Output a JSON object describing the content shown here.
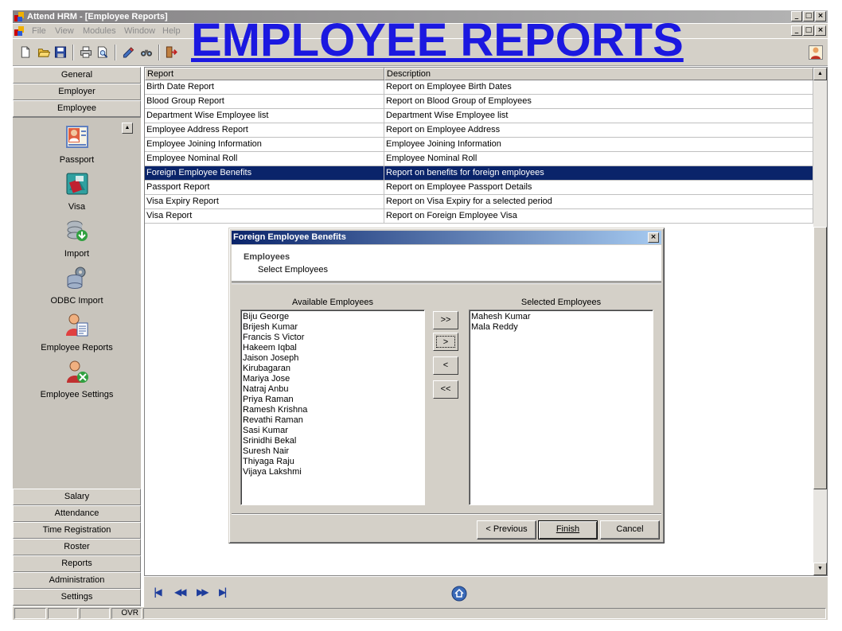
{
  "window": {
    "title": "Attend HRM - [Employee Reports]",
    "controls": {
      "minimize": "_",
      "maximize": "□",
      "close": "×"
    }
  },
  "menu": [
    "File",
    "View",
    "Modules",
    "Window",
    "Help"
  ],
  "overlay_title": "EMPLOYEE REPORTS",
  "categories_top": [
    "General",
    "Employer",
    "Employee"
  ],
  "nav_items": [
    {
      "label": "Passport",
      "icon": "passport-icon"
    },
    {
      "label": "Visa",
      "icon": "visa-icon"
    },
    {
      "label": "Import",
      "icon": "import-icon"
    },
    {
      "label": "ODBC Import",
      "icon": "odbc-import-icon"
    },
    {
      "label": "Employee Reports",
      "icon": "employee-reports-icon"
    },
    {
      "label": "Employee Settings",
      "icon": "employee-settings-icon"
    }
  ],
  "categories_bottom": [
    "Salary",
    "Attendance",
    "Time Registration",
    "Roster",
    "Reports",
    "Administration",
    "Settings"
  ],
  "grid": {
    "columns": [
      "Report",
      "Description"
    ],
    "selected_index": 6,
    "rows": [
      [
        "Birth Date Report",
        "Report on Employee Birth Dates"
      ],
      [
        "Blood Group Report",
        "Report on Blood Group of Employees"
      ],
      [
        "Department Wise Employee list",
        "Department Wise Employee list"
      ],
      [
        "Employee Address Report",
        "Report on Employee Address"
      ],
      [
        "Employee Joining Information",
        "Employee Joining Information"
      ],
      [
        "Employee Nominal Roll",
        "Employee Nominal Roll"
      ],
      [
        "Foreign Employee Benefits",
        "Report on benefits for foreign employees"
      ],
      [
        "Passport Report",
        "Report on Employee Passport Details"
      ],
      [
        "Visa Expiry Report",
        "Report on Visa Expiry for a selected period"
      ],
      [
        "Visa Report",
        "Report on Foreign Employee Visa"
      ]
    ]
  },
  "status": {
    "ovr": "OVR"
  },
  "dialog": {
    "title": "Foreign Employee Benefits",
    "close": "×",
    "header_title": "Employees",
    "header_subtitle": "Select Employees",
    "available_label": "Available Employees",
    "selected_label": "Selected Employees",
    "available": [
      "Biju George",
      "Brijesh Kumar",
      "Francis S  Victor",
      "Hakeem Iqbal",
      "Jaison Joseph",
      "Kirubagaran",
      "Mariya Jose",
      "Natraj Anbu",
      "Priya Raman",
      "Ramesh Krishna",
      "Revathi Raman",
      "Sasi Kumar",
      "Srinidhi Bekal",
      "Suresh Nair",
      "Thiyaga Raju",
      "Vijaya  Lakshmi"
    ],
    "selected": [
      "Mahesh Kumar",
      "Mala Reddy"
    ],
    "move_buttons": {
      "add_all": ">>",
      "add": ">",
      "remove": "<",
      "remove_all": "<<"
    },
    "buttons": {
      "previous": "< Previous",
      "finish": "Finish",
      "cancel": "Cancel"
    }
  },
  "colors": {
    "selection": "#0a246a",
    "title_accent": "#1b18e0",
    "panel": "#d4d0c8"
  }
}
